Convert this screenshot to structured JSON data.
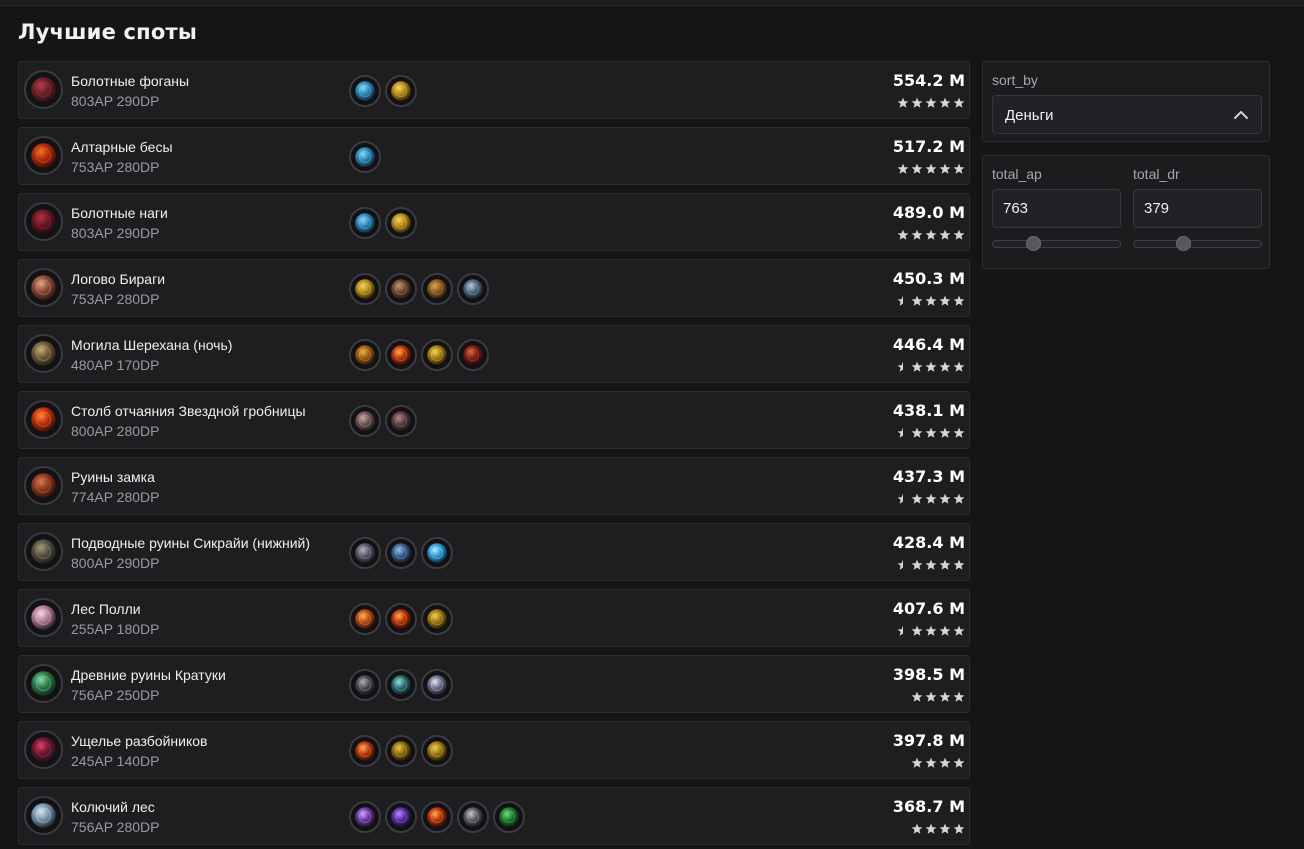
{
  "page_title": "Лучшие споты",
  "colors": {
    "background": "#151517",
    "row": "#1e1e21",
    "accent": "#ffffff",
    "muted": "#9a9aa2"
  },
  "controls": {
    "sort_label": "sort_by",
    "sort_value": "Деньги",
    "ap_label": "total_ap",
    "ap_value": "763",
    "ap_slider_fraction": 0.31,
    "dr_label": "total_dr",
    "dr_value": "379",
    "dr_slider_fraction": 0.38
  },
  "spots": [
    {
      "name": "Болотные фоганы",
      "stats": "803AP 290DP",
      "money": "554.2 M",
      "rating": 5,
      "icon": "fogan-icon",
      "loot": [
        "blue-ornament",
        "gold-ornament"
      ]
    },
    {
      "name": "Алтарные бесы",
      "stats": "753AP 280DP",
      "money": "517.2 M",
      "rating": 5,
      "icon": "imp-icon",
      "loot": [
        "blue-ornament"
      ]
    },
    {
      "name": "Болотные наги",
      "stats": "803AP 290DP",
      "money": "489.0 M",
      "rating": 5,
      "icon": "naga-icon",
      "loot": [
        "blue-ornament",
        "gold-ornament"
      ]
    },
    {
      "name": "Логово Бираги",
      "stats": "753AP 280DP",
      "money": "450.3 M",
      "rating": 4.5,
      "icon": "biraga-icon",
      "loot": [
        "gold-ornament",
        "wooden-key",
        "bronze-key",
        "silver-key"
      ]
    },
    {
      "name": "Могила Шерехана (ночь)",
      "stats": "480AP 170DP",
      "money": "446.4 M",
      "rating": 4.5,
      "icon": "grave-icon",
      "loot": [
        "gold-box",
        "red-orb",
        "gold-blade",
        "red-scroll"
      ]
    },
    {
      "name": "Столб отчаяния Звездной гробницы",
      "stats": "800AP 280DP",
      "money": "438.1 M",
      "rating": 4.5,
      "icon": "pillar-icon",
      "loot": [
        "stone-shard",
        "potion-flask"
      ]
    },
    {
      "name": "Руины замка",
      "stats": "774AP 280DP",
      "money": "437.3 M",
      "rating": 4.5,
      "icon": "castle-icon",
      "loot": []
    },
    {
      "name": "Подводные руины Сикрайи (нижний)",
      "stats": "800AP 290DP",
      "money": "428.4 M",
      "rating": 4.5,
      "icon": "sycraia-icon",
      "loot": [
        "helm-grey",
        "blue-crystal",
        "blue-orb"
      ]
    },
    {
      "name": "Лес Полли",
      "stats": "255AP 180DP",
      "money": "407.6 M",
      "rating": 4.5,
      "icon": "mushroom-icon",
      "loot": [
        "fire-jar",
        "red-orb",
        "gold-emblem"
      ]
    },
    {
      "name": "Древние руины Кратуки",
      "stats": "756AP 250DP",
      "money": "398.5 M",
      "rating": 4,
      "icon": "kratuga-icon",
      "loot": [
        "dark-spear",
        "teal-horn",
        "white-orb"
      ]
    },
    {
      "name": "Ущелье разбойников",
      "stats": "245AP 140DP",
      "money": "397.8 M",
      "rating": 4,
      "icon": "bandit-icon",
      "loot": [
        "red-orb",
        "gold-ring",
        "gold-emblem"
      ]
    },
    {
      "name": "Колючий лес",
      "stats": "756AP 280DP",
      "money": "368.7 M",
      "rating": 4,
      "icon": "thorn-icon",
      "loot": [
        "purple-helm",
        "purple-crystal",
        "red-orb",
        "grey-claw",
        "green-leaf"
      ]
    }
  ]
}
